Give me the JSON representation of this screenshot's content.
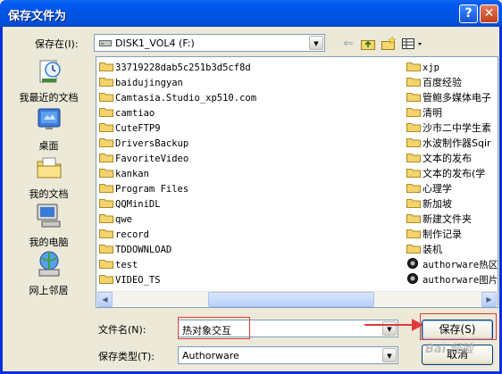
{
  "window": {
    "title": "保存文件为",
    "help_glyph": "?",
    "close_glyph": "✕"
  },
  "location": {
    "label": "保存在(I):",
    "value": "DISK1_VOL4 (F:)"
  },
  "toolbar": {
    "back_icon": "back-arrow-icon",
    "up_icon": "up-folder-icon",
    "new_folder_icon": "new-folder-icon",
    "view_icon": "view-menu-icon"
  },
  "places": [
    {
      "label": "我最近的文档",
      "icon": "recent-documents-icon"
    },
    {
      "label": "桌面",
      "icon": "desktop-icon"
    },
    {
      "label": "我的文档",
      "icon": "my-documents-icon"
    },
    {
      "label": "我的电脑",
      "icon": "my-computer-icon"
    },
    {
      "label": "网上邻居",
      "icon": "network-places-icon"
    }
  ],
  "files_col1": [
    "33719228dab5c251b3d5cf8d",
    "baidujingyan",
    "Camtasia.Studio_xp510.com",
    "camtiao",
    "CuteFTP9",
    "DriversBackup",
    "FavoriteVideo",
    "kankan",
    "Program Files",
    "QQMiniDL",
    "qwe",
    "record",
    "TDDOWNLOAD",
    "test",
    "VIDEO_TS"
  ],
  "files_col2": [
    "xjp",
    "百度经验",
    "管鲍多媒体电子",
    "清明",
    "沙市二中学生素",
    "水波制作器Sqir",
    "文本的发布",
    "文本的发布(学",
    "心理学",
    "新加坡",
    "新建文件夹",
    "制作记录",
    "装机",
    "authorware热区",
    "authorware图片"
  ],
  "filename": {
    "label": "文件名(N):",
    "value": "热对象交互"
  },
  "filetype": {
    "label": "保存类型(T):",
    "value": "Authorware"
  },
  "buttons": {
    "save": "保存(S)",
    "cancel": "取消"
  },
  "watermark": "Bai 经验"
}
